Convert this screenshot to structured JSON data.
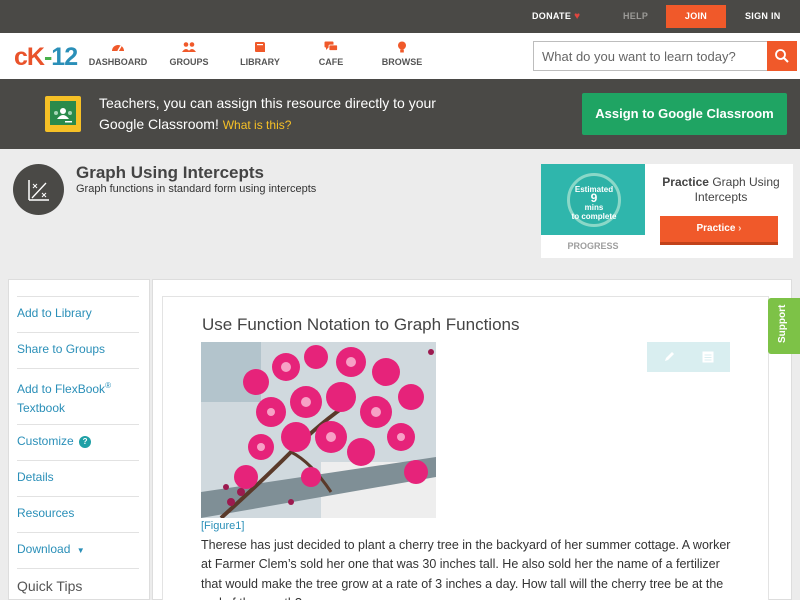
{
  "topbar": {
    "donate": "DONATE",
    "help": "HELP",
    "join": "JOIN",
    "signin": "SIGN IN"
  },
  "logo": {
    "part1": "c",
    "part2": "K",
    "part3": "-",
    "part4": "12"
  },
  "nav": {
    "items": [
      {
        "label": "DASHBOARD",
        "icon": "dashboard-icon"
      },
      {
        "label": "GROUPS",
        "icon": "groups-icon"
      },
      {
        "label": "LIBRARY",
        "icon": "library-icon"
      },
      {
        "label": "CAFE",
        "icon": "cafe-icon"
      },
      {
        "label": "BROWSE",
        "icon": "browse-icon"
      }
    ],
    "search_placeholder": "What do you want to learn today?"
  },
  "banner": {
    "text": "Teachers, you can assign this resource directly to your Google Classroom!",
    "what_is_this": "What is this?",
    "assign_button": "Assign to Google Classroom"
  },
  "header": {
    "title": "Graph Using Intercepts",
    "subtitle": "Graph functions in standard form using intercepts"
  },
  "practice": {
    "estimated": "Estimated",
    "minutes": "9",
    "mins_label": "mins",
    "to_complete": "to complete",
    "progress": "PROGRESS",
    "title_bold": "Practice",
    "title_rest": "Graph Using Intercepts",
    "button": "Practice"
  },
  "sidebar": {
    "add_library": "Add to Library",
    "share_groups": "Share to Groups",
    "add_flexbook_1": "Add to FlexBook",
    "add_flexbook_reg": "®",
    "add_flexbook_2": "Textbook",
    "customize": "Customize",
    "details": "Details",
    "resources": "Resources",
    "download": "Download",
    "quick_tips": "Quick Tips"
  },
  "article": {
    "title": "Use Function Notation to Graph Functions",
    "figure_label": "[Figure1]",
    "body": "Therese has just decided to plant a cherry tree in the backyard of her summer cottage. A worker at Farmer Clem’s sold her one that was 30 inches tall. He also sold her the name of a fertilizer that would make the tree grow at a rate of 3 inches a day. How tall will the cherry tree be at the end of the month?"
  },
  "support": "Support",
  "colors": {
    "brand_orange": "#f0592a",
    "brand_blue": "#2a8fb8",
    "classroom_green": "#1fa463",
    "dark_bar": "#4a4946"
  }
}
